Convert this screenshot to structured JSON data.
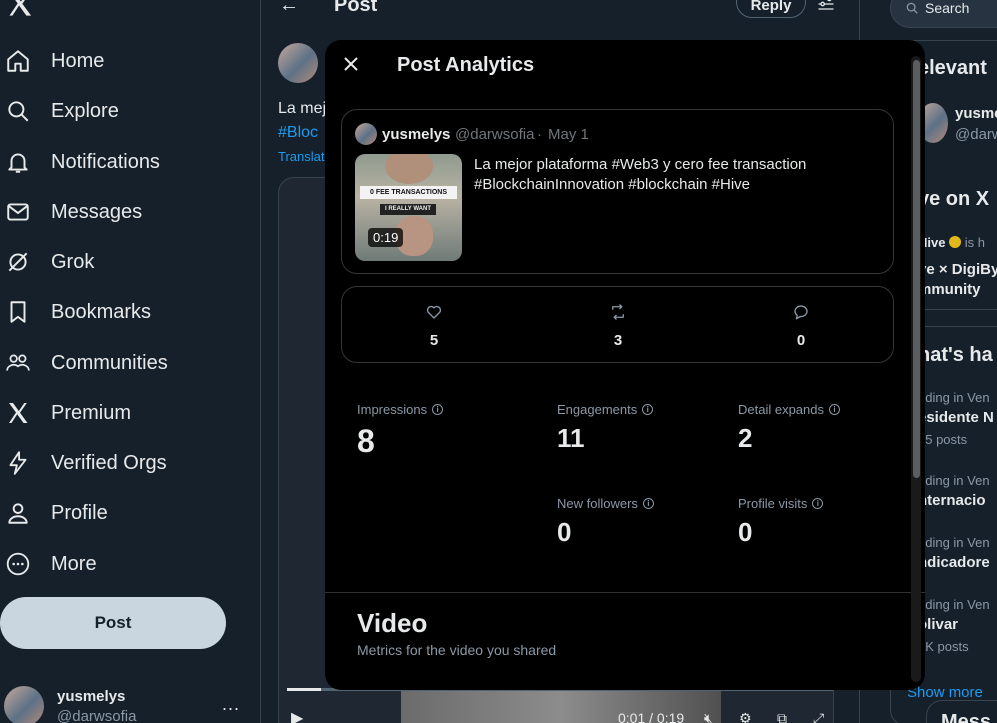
{
  "sidebar": {
    "nav": [
      {
        "label": "Home",
        "icon": "home-icon"
      },
      {
        "label": "Explore",
        "icon": "search-icon"
      },
      {
        "label": "Notifications",
        "icon": "bell-icon"
      },
      {
        "label": "Messages",
        "icon": "envelope-icon"
      },
      {
        "label": "Grok",
        "icon": "grok-icon"
      },
      {
        "label": "Bookmarks",
        "icon": "bookmark-icon"
      },
      {
        "label": "Communities",
        "icon": "people-icon"
      },
      {
        "label": "Premium",
        "icon": "x-logo-icon"
      },
      {
        "label": "Verified Orgs",
        "icon": "lightning-icon"
      },
      {
        "label": "Profile",
        "icon": "person-icon"
      },
      {
        "label": "More",
        "icon": "more-circle-icon"
      }
    ],
    "post_button": "Post",
    "account": {
      "name": "yusmelys",
      "handle": "@darwsofia",
      "more": "..."
    }
  },
  "main": {
    "back": "←",
    "title": "Post",
    "reply_button": "Reply",
    "text_line1": "La mej",
    "text_line2": "#Bloc",
    "translate": "Translat",
    "video_time": "0:01 / 0:19"
  },
  "right": {
    "search_placeholder": "Search",
    "relevant": "elevant",
    "rel_user_name": "yusme",
    "rel_user_handle": "@darw",
    "live_heading": "ve on X",
    "live_host": "Hive",
    "live_host_suffix": "is h",
    "live_line1": "ve × DigiBy",
    "live_line2": "mmunity",
    "happening_heading": "hat's ha",
    "trends": [
      {
        "context": "nding in Ven",
        "name": "esidente N",
        "count": "85 posts"
      },
      {
        "context": "nding in Ven",
        "name": "nternacio",
        "count": ""
      },
      {
        "context": "nding in Ven",
        "name": "ndicadore",
        "count": ""
      },
      {
        "context": "nding in Ven",
        "name": "olivar",
        "count": "4K posts"
      }
    ],
    "show_more": "Show more",
    "messages_partial": "Mess"
  },
  "modal": {
    "title": "Post Analytics",
    "post": {
      "name": "yusmelys",
      "handle": "@darwsofia",
      "separator": "·",
      "date": "May 1",
      "text": "La mejor plataforma #Web3 y cero fee transaction #BlockchainInnovation #blockchain #Hive",
      "thumb_caption1": "0 FEE TRANSACTIONS",
      "thumb_caption2": "I REALLY WANT",
      "duration": "0:19"
    },
    "engagement": {
      "likes": "5",
      "reposts": "3",
      "replies": "0"
    },
    "metrics": {
      "impressions": {
        "label": "Impressions",
        "value": "8"
      },
      "engagements": {
        "label": "Engagements",
        "value": "11"
      },
      "detail_expands": {
        "label": "Detail expands",
        "value": "2"
      },
      "new_followers": {
        "label": "New followers",
        "value": "0"
      },
      "profile_visits": {
        "label": "Profile visits",
        "value": "0"
      }
    },
    "video_section": {
      "title": "Video",
      "subtitle": "Metrics for the video you shared"
    }
  },
  "colors": {
    "background": "#15202b",
    "modal": "#000000",
    "accent": "#1d9bf0",
    "post_button": "#c9d6df"
  }
}
